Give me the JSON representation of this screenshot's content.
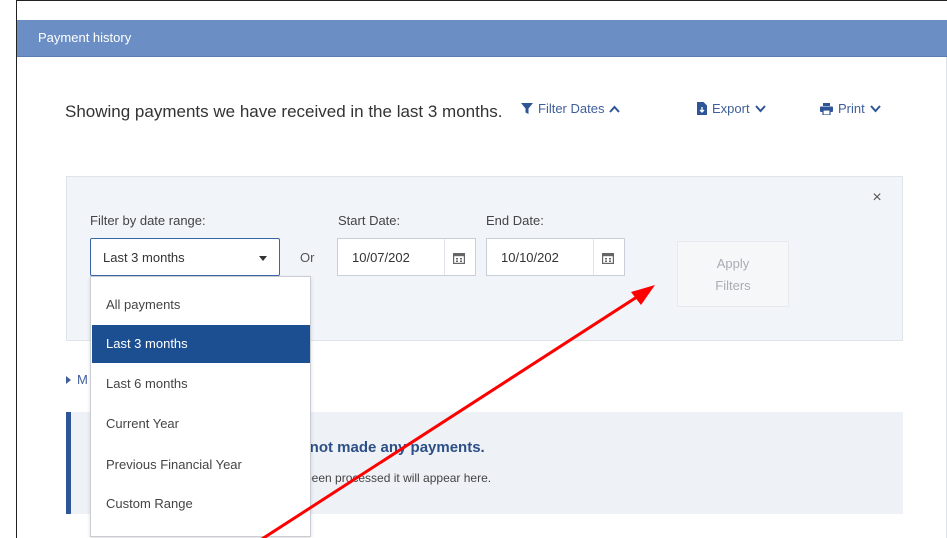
{
  "header": {
    "title": "Payment history"
  },
  "intro": {
    "text": "Showing payments we have received in the last 3 months."
  },
  "toolbar": {
    "filter_dates": "Filter Dates",
    "export": "Export",
    "print": "Print"
  },
  "filter": {
    "range_label": "Filter by date range:",
    "range_value": "Last 3 months",
    "or_label": "Or",
    "start_label": "Start Date:",
    "start_value": "10/07/202",
    "end_label": "End Date:",
    "end_value": "10/10/202",
    "apply_line1": "Apply",
    "apply_line2": "Filters",
    "close_symbol": "×"
  },
  "dropdown": {
    "options": [
      "All payments",
      "Last 3 months",
      "Last 6 months",
      "Current Year",
      "Previous Financial Year",
      "Custom Range"
    ],
    "selected": "Last 3 months"
  },
  "more_link": {
    "visible_text": "M"
  },
  "notice": {
    "title_fragment": "ly not made any payments.",
    "text_fragment": "been processed it will appear here."
  },
  "colors": {
    "header_bg": "#6b8fc4",
    "link": "#3f5f9a",
    "selected_bg": "#1c4f92",
    "notice_border": "#2e5596",
    "annotation_arrow": "#ff0000"
  }
}
